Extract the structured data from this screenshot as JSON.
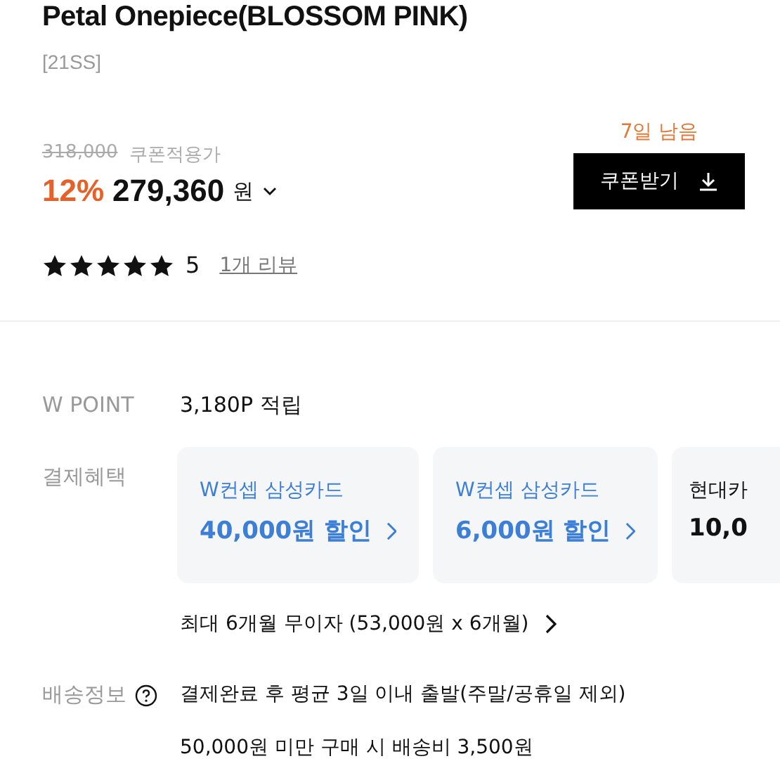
{
  "product": {
    "title": "Petal Onepiece(BLOSSOM PINK)",
    "season": "[21SS]"
  },
  "price": {
    "original": "318,000",
    "coupon_label": "쿠폰적용가",
    "discount": "12%",
    "amount": "279,360",
    "currency": "원",
    "days_left": "7일 남음",
    "coupon_button": "쿠폰받기"
  },
  "rating": {
    "stars": 5,
    "score": "5",
    "reviews": "1개 리뷰"
  },
  "w_point": {
    "label": "W POINT",
    "value": "3,180P 적립"
  },
  "payment": {
    "label": "결제혜택",
    "cards": [
      {
        "name": "W컨셉 삼성카드",
        "benefit": "40,000원 할인",
        "kind": "highlight"
      },
      {
        "name": "W컨셉 삼성카드",
        "benefit": "6,000원 할인",
        "kind": "highlight"
      },
      {
        "name": "현대카",
        "benefit": "10,0",
        "kind": "plain"
      }
    ],
    "installment": "최대 6개월 무이자 (53,000원 x 6개월)"
  },
  "shipping": {
    "label": "배송정보",
    "lines": [
      "결제완료 후 평균 3일 이내 출발(주말/공휴일 제외)",
      "50,000원 미만 구매 시 배송비 3,500원"
    ]
  }
}
